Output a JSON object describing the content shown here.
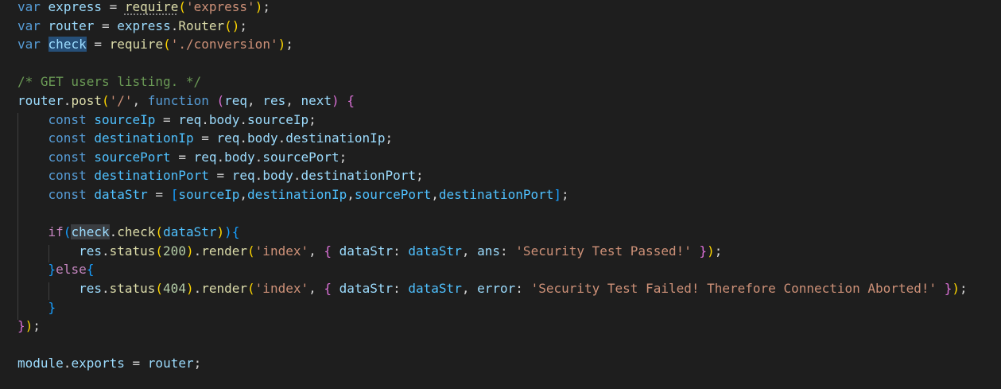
{
  "editor": {
    "language": "javascript",
    "theme_colors": {
      "background": "#1e1e1e",
      "keyword": "#569cd6",
      "control": "#c586c0",
      "variable": "#9cdcfe",
      "function": "#dcdcaa",
      "string": "#ce9178",
      "number": "#b5cea8",
      "comment": "#6a9955",
      "selection": "#264f78"
    },
    "tokens": {
      "var": "var",
      "const": "const",
      "function": "function",
      "if": "if",
      "else": "else",
      "express": "express",
      "router": "router",
      "check": "check",
      "require": "require",
      "Router": "Router",
      "post": "post",
      "req": "req",
      "res": "res",
      "next": "next",
      "body": "body",
      "sourceIp": "sourceIp",
      "destinationIp": "destinationIp",
      "sourcePort": "sourcePort",
      "destinationPort": "destinationPort",
      "dataStr": "dataStr",
      "status": "status",
      "render": "render",
      "ans": "ans",
      "error": "error",
      "module": "module",
      "exports": "exports",
      "str_express": "'express'",
      "str_conversion": "'./conversion'",
      "str_slash": "'/'",
      "str_index": "'index'",
      "str_passed": "'Security Test Passed!'",
      "str_failed": "'Security Test Failed! Therefore Connection Aborted!'",
      "num_200": "200",
      "num_404": "404",
      "comment": "/* GET users listing. */"
    }
  }
}
